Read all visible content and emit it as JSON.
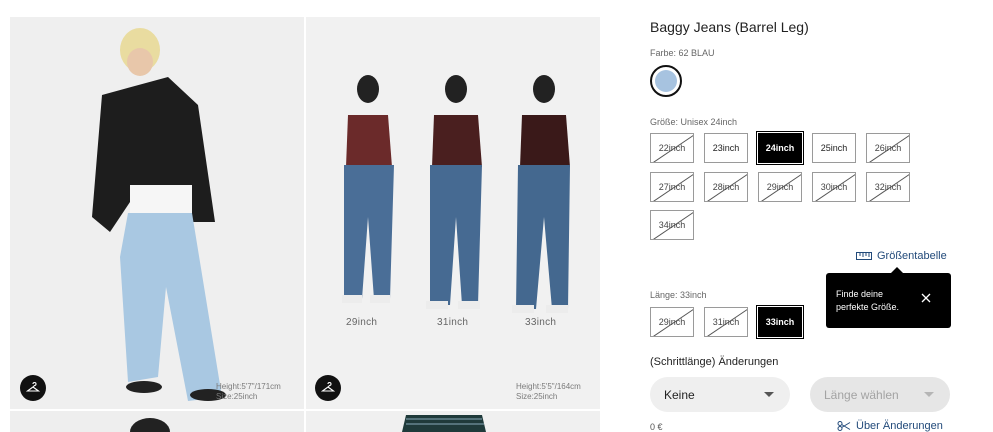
{
  "product": {
    "title": "Baggy Jeans (Barrel Leg)",
    "color_label": "Farbe: 62 BLAU",
    "color_swatch": "#a7c3e0",
    "size_label": "Größe: Unisex 24inch",
    "sizes": [
      {
        "label": "22inch",
        "available": false
      },
      {
        "label": "23inch",
        "available": true
      },
      {
        "label": "24inch",
        "available": true,
        "selected": true
      },
      {
        "label": "25inch",
        "available": true
      },
      {
        "label": "26inch",
        "available": false
      },
      {
        "label": "27inch",
        "available": false
      },
      {
        "label": "28inch",
        "available": false
      },
      {
        "label": "29inch",
        "available": false
      },
      {
        "label": "30inch",
        "available": false
      },
      {
        "label": "32inch",
        "available": false
      },
      {
        "label": "34inch",
        "available": false
      }
    ],
    "size_chart_link": "Größentabelle",
    "tooltip_text": "Finde deine perfekte Größe.",
    "length_label": "Länge: 33inch",
    "lengths": [
      {
        "label": "29inch",
        "available": false
      },
      {
        "label": "31inch",
        "available": false
      },
      {
        "label": "33inch",
        "available": true,
        "selected": true
      }
    ],
    "alterations_title": "(Schrittlänge) Änderungen",
    "alteration_select": "Keine",
    "length_select_placeholder": "Länge wählen",
    "price": "0 €",
    "alterations_link": "Über Änderungen"
  },
  "gallery": {
    "photo1_model_info": "Height:5'7\"/171cm",
    "photo1_model_size": "Size:25inch",
    "photo2_model_info": "Height:5'5\"/164cm",
    "photo2_model_size": "Size:25inch",
    "photo2_captions": [
      "29inch",
      "31inch",
      "33inch"
    ]
  },
  "colors": {
    "accent_link": "#224a7a",
    "tooltip_bg": "#000000",
    "selected_size_bg": "#000000"
  },
  "icons": [
    "hanger-icon",
    "ruler-icon",
    "close-icon",
    "scissors-icon",
    "chevron-down-icon"
  ]
}
